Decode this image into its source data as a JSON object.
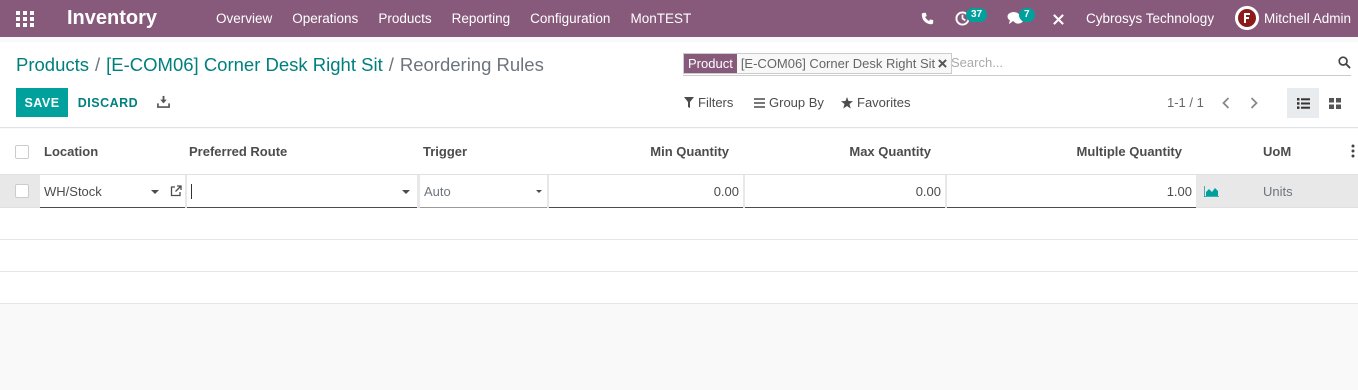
{
  "navbar": {
    "app_name": "Inventory",
    "menu": [
      "Overview",
      "Operations",
      "Products",
      "Reporting",
      "Configuration",
      "MonTEST"
    ],
    "activity_count": "37",
    "message_count": "7",
    "company": "Cybrosys Technology",
    "user": "Mitchell Admin"
  },
  "breadcrumb": {
    "root": "Products",
    "product": "[E-COM06] Corner Desk Right Sit",
    "current": "Reordering Rules",
    "separator": "/"
  },
  "search": {
    "facet_label": "Product",
    "facet_value": "[E-COM06] Corner Desk Right Sit",
    "placeholder": "Search..."
  },
  "toolbar": {
    "save_label": "SAVE",
    "discard_label": "DISCARD",
    "filters_label": "Filters",
    "group_by_label": "Group By",
    "favorites_label": "Favorites",
    "pager": "1-1 / 1"
  },
  "table": {
    "columns": {
      "location": "Location",
      "route": "Preferred Route",
      "trigger": "Trigger",
      "min_qty": "Min Quantity",
      "max_qty": "Max Quantity",
      "multiple_qty": "Multiple Quantity",
      "uom": "UoM"
    },
    "row": {
      "location": "WH/Stock",
      "route": "",
      "trigger": "Auto",
      "min_qty": "0.00",
      "max_qty": "0.00",
      "multiple_qty": "1.00",
      "uom": "Units"
    }
  },
  "colors": {
    "brand": "#875a7b",
    "accent": "#00a09d"
  }
}
